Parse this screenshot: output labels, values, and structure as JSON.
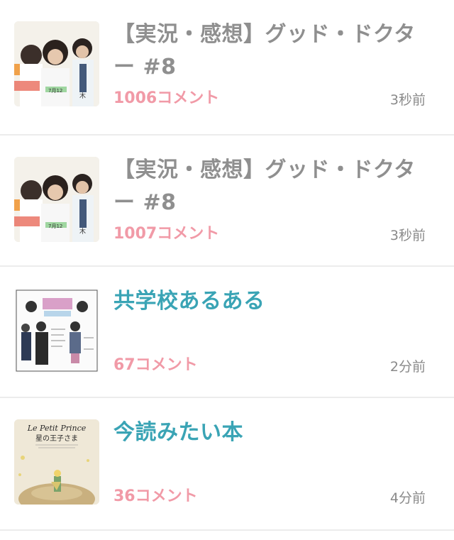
{
  "threads": [
    {
      "title": "【実況・感想】グッド・ドクター #8",
      "comments": "1006",
      "comments_suffix": "コメント",
      "time": "3秒前",
      "state": "read",
      "thumbnail": "drama-poster-thumbnail"
    },
    {
      "title": "【実況・感想】グッド・ドクター #8",
      "comments": "1007",
      "comments_suffix": "コメント",
      "time": "3秒前",
      "state": "read",
      "thumbnail": "drama-poster-thumbnail"
    },
    {
      "title": "共学校あるある",
      "comments": "67",
      "comments_suffix": "コメント",
      "time": "2分前",
      "state": "unread",
      "thumbnail": "illustration-thumbnail"
    },
    {
      "title": "今読みたい本",
      "comments": "36",
      "comments_suffix": "コメント",
      "time": "4分前",
      "state": "unread",
      "thumbnail": "book-cover-thumbnail",
      "thumb_text": [
        "Le Petit Prince",
        "星の王子さま"
      ]
    }
  ],
  "colors": {
    "title_read": "#8f8f8f",
    "title_unread": "#3aa4b5",
    "comment_count": "#f19aa7",
    "time": "#8a8a8a",
    "divider": "#ececec"
  }
}
